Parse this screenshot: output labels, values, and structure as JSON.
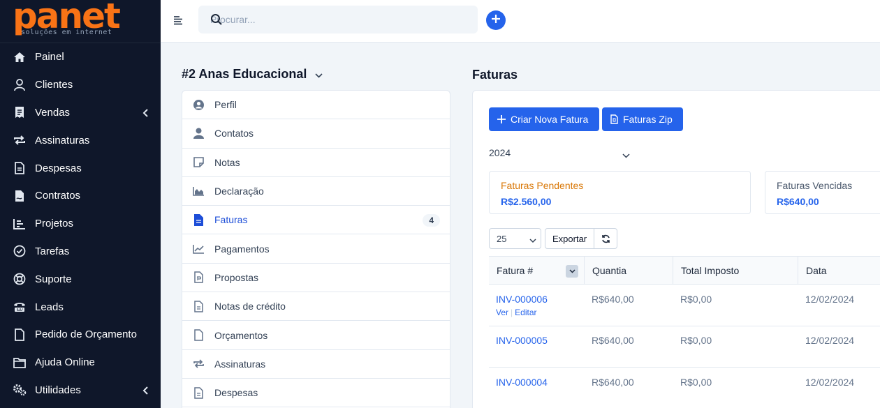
{
  "brand": {
    "logo_text": "panet",
    "tagline": "soluções em internet",
    "color": "#f97316"
  },
  "sidebar": {
    "items": [
      {
        "label": "Painel",
        "icon": "home-icon"
      },
      {
        "label": "Clientes",
        "icon": "user-icon"
      },
      {
        "label": "Vendas",
        "icon": "receipt-icon",
        "has_caret": true
      },
      {
        "label": "Assinaturas",
        "icon": "repeat-icon"
      },
      {
        "label": "Despesas",
        "icon": "file-icon"
      },
      {
        "label": "Contratos",
        "icon": "contract-icon"
      },
      {
        "label": "Projetos",
        "icon": "chart-icon"
      },
      {
        "label": "Tarefas",
        "icon": "check-circle-icon"
      },
      {
        "label": "Suporte",
        "icon": "lifebuoy-icon"
      },
      {
        "label": "Leads",
        "icon": "tty-icon"
      },
      {
        "label": "Pedido de Orçamento",
        "icon": "file-icon"
      },
      {
        "label": "Ajuda Online",
        "icon": "folder-icon"
      },
      {
        "label": "Utilidades",
        "icon": "gears-icon",
        "has_caret": true
      }
    ]
  },
  "topbar": {
    "search_placeholder": "Procurar..."
  },
  "client": {
    "title": "#2 Anas Educacional",
    "tabs": [
      {
        "label": "Perfil",
        "icon": "user-circle-icon"
      },
      {
        "label": "Contatos",
        "icon": "user-icon"
      },
      {
        "label": "Notas",
        "icon": "note-icon"
      },
      {
        "label": "Declaração",
        "icon": "area-chart-icon"
      },
      {
        "label": "Faturas",
        "icon": "invoice-icon",
        "active": true,
        "badge": "4"
      },
      {
        "label": "Pagamentos",
        "icon": "line-chart-icon"
      },
      {
        "label": "Propostas",
        "icon": "proposal-icon"
      },
      {
        "label": "Notas de crédito",
        "icon": "file-text-icon"
      },
      {
        "label": "Orçamentos",
        "icon": "file-icon"
      },
      {
        "label": "Assinaturas",
        "icon": "repeat-icon"
      },
      {
        "label": "Despesas",
        "icon": "file-text-icon"
      }
    ]
  },
  "invoices": {
    "section_title": "Faturas",
    "btn_new": "Criar Nova Fatura",
    "btn_zip": "Faturas Zip",
    "year": "2024",
    "stats": [
      {
        "label": "Faturas Pendentes",
        "value": "R$2.560,00",
        "label_color": "#d97706"
      },
      {
        "label": "Faturas Vencidas",
        "value": "R$640,00",
        "label_color": "#475569"
      }
    ],
    "page_size": "25",
    "export_label": "Exportar",
    "columns": [
      "Fatura #",
      "Quantia",
      "Total Imposto",
      "Data"
    ],
    "rows": [
      {
        "number": "INV-000006",
        "amount": "R$640,00",
        "tax": "R$0,00",
        "date": "12/02/2024",
        "view": "Ver",
        "edit": "Editar"
      },
      {
        "number": "INV-000005",
        "amount": "R$640,00",
        "tax": "R$0,00",
        "date": "12/02/2024"
      },
      {
        "number": "INV-000004",
        "amount": "R$640,00",
        "tax": "R$0,00",
        "date": "12/02/2024"
      }
    ]
  },
  "colors": {
    "accent": "#2563eb",
    "sidebar_bg": "#0f172a"
  }
}
